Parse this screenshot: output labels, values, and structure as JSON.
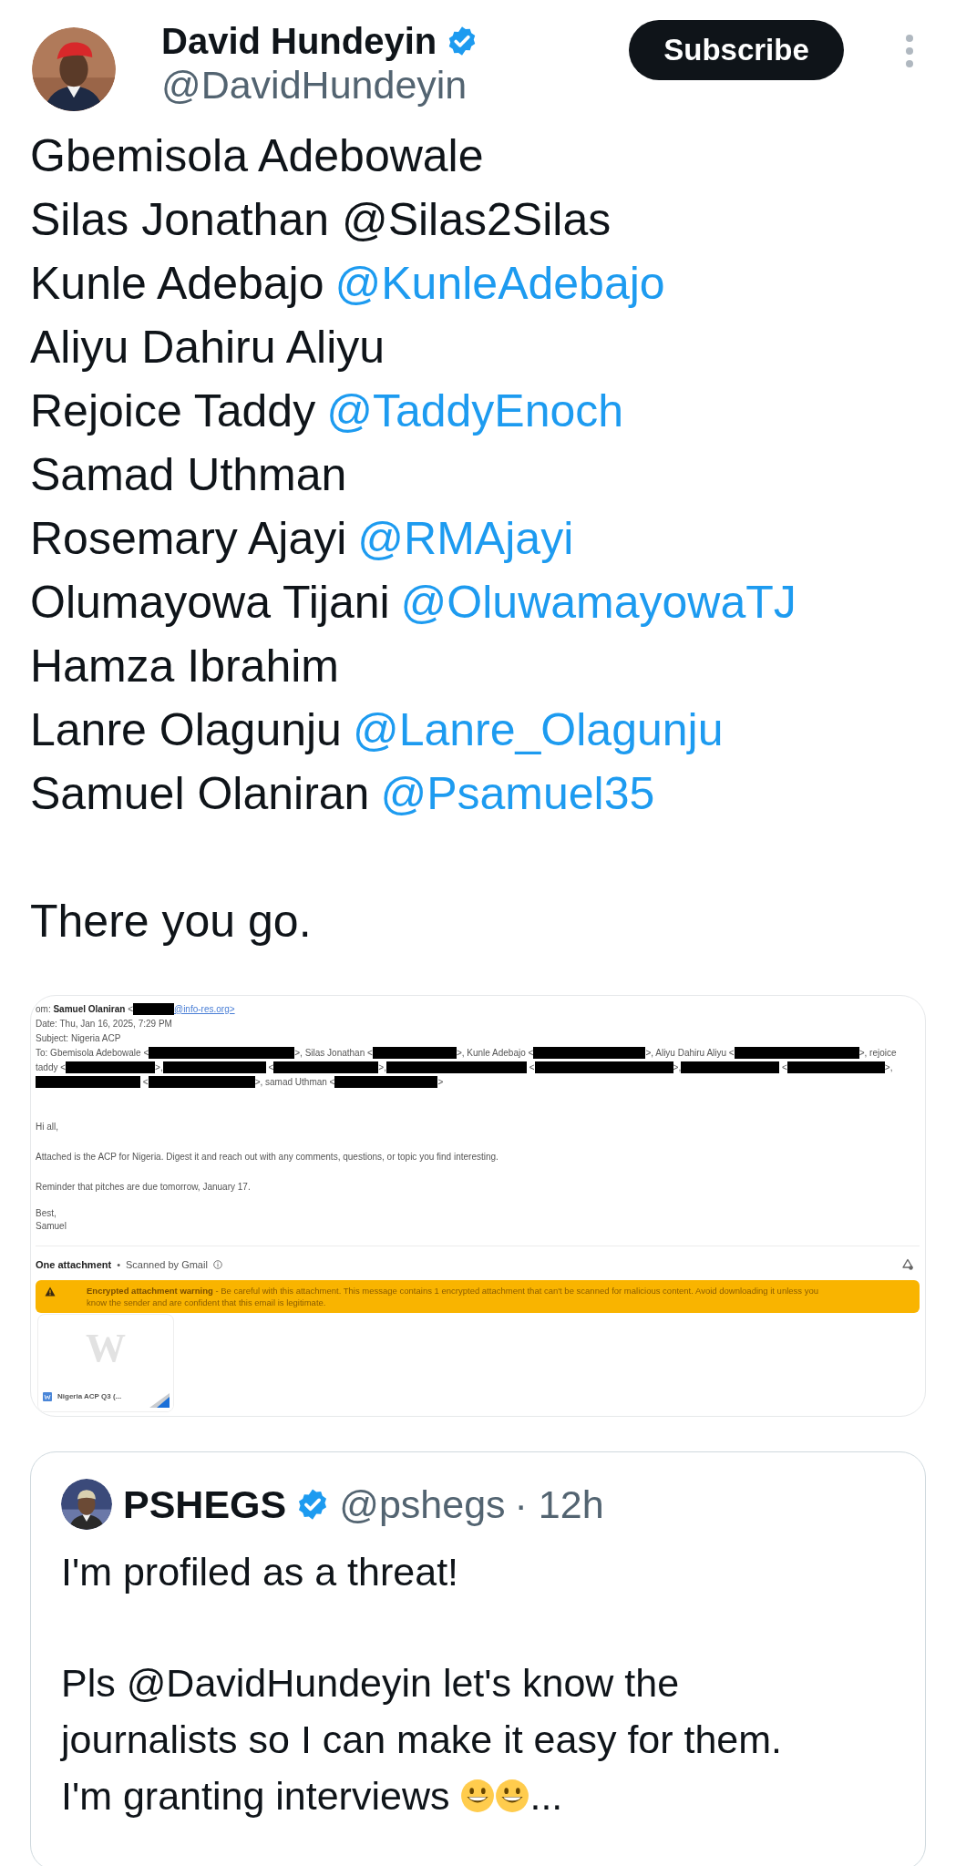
{
  "author": {
    "name": "David Hundeyin",
    "handle": "@DavidHundeyin",
    "verified": true,
    "subscribe_label": "Subscribe"
  },
  "tweet": {
    "lines": [
      {
        "name": "Gbemisola Adebowale"
      },
      {
        "name": "Silas Jonathan @Silas2Silas"
      },
      {
        "name": "Kunle Adebajo",
        "mention": "@KunleAdebajo"
      },
      {
        "name": "Aliyu Dahiru Aliyu"
      },
      {
        "name": "Rejoice Taddy",
        "mention": "@TaddyEnoch"
      },
      {
        "name": "Samad Uthman"
      },
      {
        "name": "Rosemary Ajayi",
        "mention": "@RMAjayi"
      },
      {
        "name": "Olumayowa Tijani",
        "mention": "@OluwamayowaTJ"
      },
      {
        "name": "Hamza Ibrahim"
      },
      {
        "name": "Lanre Olagunju",
        "mention": "@Lanre_Olagunju"
      },
      {
        "name": "Samuel Olaniran",
        "mention": "@Psamuel35"
      }
    ],
    "closing": "There you go."
  },
  "email": {
    "header_lines": [
      [
        {
          "kind": "text",
          "text": "om: "
        },
        {
          "kind": "bold",
          "text": "Samuel Olaniran"
        },
        {
          "kind": "text",
          "text": " <"
        },
        {
          "kind": "redacted"
        },
        {
          "kind": "link",
          "text": "@info-res.org>"
        }
      ],
      [
        {
          "kind": "text",
          "text": "Date: Thu, Jan 16, 2025, 7:29 PM"
        }
      ],
      [
        {
          "kind": "text",
          "text": "Subject: Nigeria ACP"
        }
      ],
      [
        {
          "kind": "text",
          "text": "To: Gbemisola Adebowale <"
        },
        {
          "kind": "redacted"
        },
        {
          "kind": "text",
          "text": ">, Silas Jonathan <"
        },
        {
          "kind": "redacted"
        },
        {
          "kind": "text",
          "text": ">, Kunle Adebajo <"
        },
        {
          "kind": "redacted"
        },
        {
          "kind": "text",
          "text": ">, Aliyu Dahiru Aliyu <"
        },
        {
          "kind": "redacted"
        },
        {
          "kind": "text",
          "text": ">, rejoice"
        }
      ],
      [
        {
          "kind": "text",
          "text": "taddy <"
        },
        {
          "kind": "redacted"
        },
        {
          "kind": "text",
          "text": ">,"
        },
        {
          "kind": "redacted"
        },
        {
          "kind": "text",
          "text": " <"
        },
        {
          "kind": "redacted"
        },
        {
          "kind": "text",
          "text": ">,"
        },
        {
          "kind": "redacted"
        },
        {
          "kind": "text",
          "text": " <"
        },
        {
          "kind": "redacted"
        },
        {
          "kind": "text",
          "text": ">,"
        },
        {
          "kind": "redacted"
        },
        {
          "kind": "text",
          "text": " <"
        },
        {
          "kind": "redacted"
        },
        {
          "kind": "text",
          "text": ">,"
        }
      ],
      [
        {
          "kind": "redacted"
        },
        {
          "kind": "text",
          "text": " <"
        },
        {
          "kind": "redacted"
        },
        {
          "kind": "text",
          "text": ">, samad Uthman <"
        },
        {
          "kind": "redacted"
        },
        {
          "kind": "text",
          "text": ">"
        }
      ]
    ],
    "body": [
      "Hi all,",
      "Attached is the ACP for Nigeria. Digest it and reach out with any comments, questions, or topic you find interesting.",
      "Reminder that pitches are due tomorrow, January 17."
    ],
    "signoff": [
      "Best,",
      "Samuel"
    ],
    "attachments_label": "One attachment",
    "separator": "•",
    "scan_note": "Scanned by Gmail",
    "warning": {
      "title": "Encrypted attachment warning",
      "text": " - Be careful with this attachment. This message contains 1 encrypted attachment that can't be scanned for malicious content. Avoid downloading it unless you know the sender and are confident that this email is legitimate."
    },
    "attachment": {
      "preview_letter": "W",
      "filename": "Nigeria ACP Q3 (..."
    }
  },
  "quote": {
    "name": "PSHEGS",
    "verified": true,
    "handle": "@pshegs",
    "time": "· 12h",
    "paragraphs": [
      {
        "text": "I'm profiled as a threat!"
      },
      {
        "lines": [
          "Pls @DavidHundeyin let's know the",
          "journalists so I can make it easy for them."
        ],
        "last_line": "I'm granting interviews",
        "tail": "..."
      }
    ]
  }
}
